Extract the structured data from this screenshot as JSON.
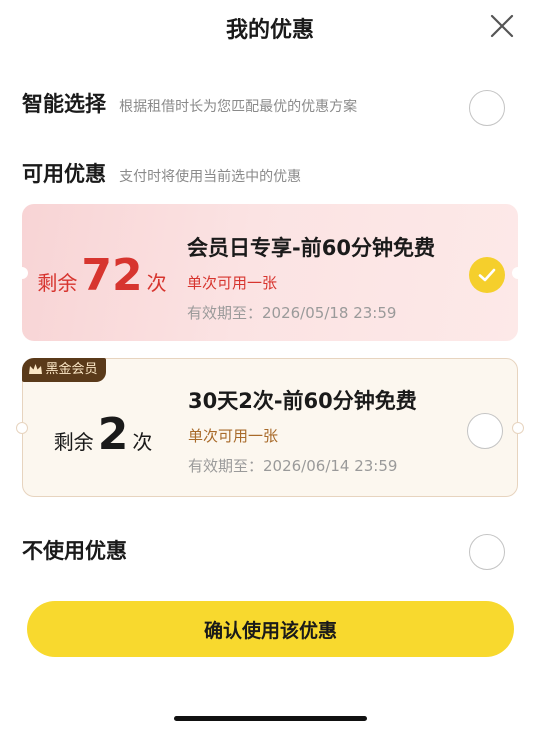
{
  "header": {
    "title": "我的优惠"
  },
  "smart": {
    "title": "智能选择",
    "subtitle": "根据租借时长为您匹配最优的优惠方案"
  },
  "available": {
    "title": "可用优惠",
    "subtitle": "支付时将使用当前选中的优惠"
  },
  "coupons": [
    {
      "count_prefix": "剩余",
      "count": "72",
      "count_suffix": "次",
      "title": "会员日专享-前60分钟免费",
      "limit": "单次可用一张",
      "valid": "有效期至：2026/05/18  23:59",
      "selected": true,
      "badge": ""
    },
    {
      "count_prefix": "剩余",
      "count": "2",
      "count_suffix": "次",
      "title": "30天2次-前60分钟免费",
      "limit": "单次可用一张",
      "valid": "有效期至：2026/06/14  23:59",
      "selected": false,
      "badge": "黑金会员"
    }
  ],
  "no_coupon": {
    "label": "不使用优惠"
  },
  "confirm": {
    "label": "确认使用该优惠"
  },
  "colors": {
    "accent_yellow": "#f8d92e",
    "check_yellow": "#f5cf2c",
    "red": "#d7352f",
    "gold_brown": "#a86a2a",
    "badge_bg": "#5a3a1a"
  },
  "icons": {
    "close": "close-icon",
    "check": "check-icon",
    "badge": "crown-icon"
  }
}
